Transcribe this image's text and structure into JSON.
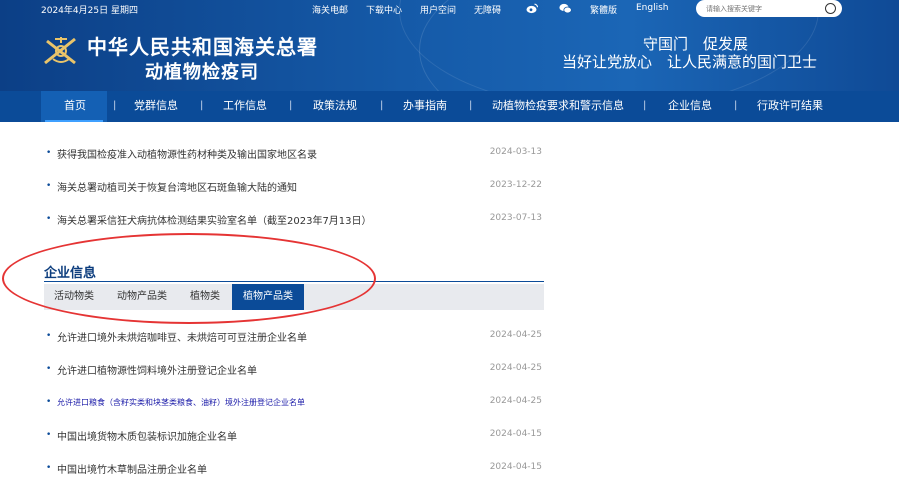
{
  "topbar": {
    "date": "2024年4月25日 星期四",
    "links": [
      "海关电邮",
      "下载中心",
      "用户空间",
      "无障碍"
    ],
    "social_icons": [
      "weibo-icon",
      "wechat-icon"
    ],
    "traditional": "繁體版",
    "english": "English",
    "search_placeholder": "请输入搜索关键字"
  },
  "header": {
    "org_line1": "中华人民共和国海关总署",
    "org_line2": "动植物检疫司",
    "slogan_line1": "守国门　促发展",
    "slogan_line2": "当好让党放心　让人民满意的国门卫士"
  },
  "nav": {
    "items": [
      "首页",
      "党群信息",
      "工作信息",
      "政策法规",
      "办事指南",
      "动植物检疫要求和警示信息",
      "企业信息",
      "行政许可结果"
    ],
    "active": "首页"
  },
  "top_list": [
    {
      "title": "获得我国检疫准入动植物源性药材种类及输出国家地区名录",
      "date": "2024-03-13"
    },
    {
      "title": "海关总署动植司关于恢复台湾地区石斑鱼输大陆的通知",
      "date": "2023-12-22"
    },
    {
      "title": "海关总署采信狂犬病抗体检测结果实验室名单（截至2023年7月13日）",
      "date": "2023-07-13"
    }
  ],
  "enterprise": {
    "title": "企业信息",
    "tabs": [
      "活动物类",
      "动物产品类",
      "植物类",
      "植物产品类"
    ],
    "active_tab": "植物产品类",
    "items": [
      {
        "title": "允许进口境外未烘焙咖啡豆、未烘焙可可豆注册企业名单",
        "date": "2024-04-25"
      },
      {
        "title": "允许进口植物源性饲料境外注册登记企业名单",
        "date": "2024-04-25"
      },
      {
        "title": "允许进口粮食（含籽实类和块茎类粮食、油籽）境外注册登记企业名单",
        "date": "2024-04-25"
      },
      {
        "title": "中国出境货物木质包装标识加施企业名单",
        "date": "2024-04-15"
      },
      {
        "title": "中国出境竹木草制品注册企业名单",
        "date": "2024-04-15"
      }
    ]
  },
  "colors": {
    "header_blue": "#155aa8",
    "nav_blue": "#0b4b98",
    "annotation_red": "#e53434"
  }
}
